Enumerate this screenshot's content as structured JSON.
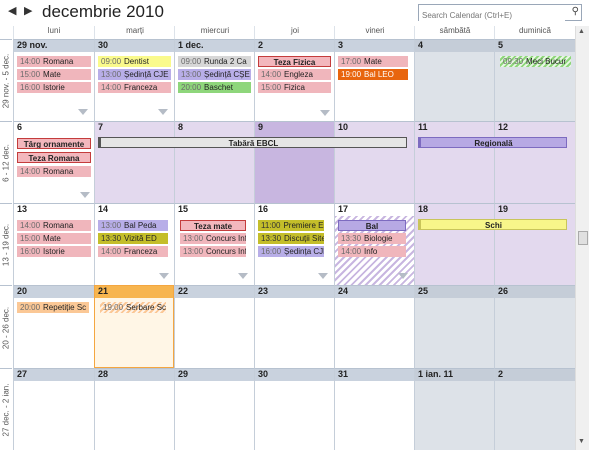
{
  "header": {
    "prev_label": "◀",
    "next_label": "▶",
    "title": "decembrie 2010",
    "search_placeholder": "Search Calendar (Ctrl+E)",
    "search_icon": "magnifier-icon"
  },
  "day_names": [
    "luni",
    "marți",
    "miercuri",
    "joi",
    "vineri",
    "sâmbătă",
    "duminică"
  ],
  "weeks": [
    {
      "label": "29 nov. - 5 dec.",
      "days": [
        "29 nov.",
        "30",
        "1 dec.",
        "2",
        "3",
        "4",
        "5"
      ]
    },
    {
      "label": "6 - 12 dec.",
      "days": [
        "6",
        "7",
        "8",
        "9",
        "10",
        "11",
        "12"
      ]
    },
    {
      "label": "13 - 19 dec.",
      "days": [
        "13",
        "14",
        "15",
        "16",
        "17",
        "18",
        "19"
      ]
    },
    {
      "label": "20 - 26 dec.",
      "days": [
        "20",
        "21",
        "22",
        "23",
        "24",
        "25",
        "26"
      ]
    },
    {
      "label": "27 dec. - 2 ian.",
      "days": [
        "27",
        "28",
        "29",
        "30",
        "31",
        "1 ian. 11",
        "2"
      ]
    }
  ],
  "events": {
    "w1": {
      "mon": [
        {
          "time": "14:00",
          "title": "Romana"
        },
        {
          "time": "15:00",
          "title": "Mate"
        },
        {
          "time": "16:00",
          "title": "Istorie"
        }
      ],
      "tue": [
        {
          "time": "09:00",
          "title": "Dentist"
        },
        {
          "time": "13:00",
          "title": "Ședință CJE"
        },
        {
          "time": "14:00",
          "title": "Franceza"
        }
      ],
      "wed": [
        {
          "time": "09:00",
          "title": "Runda 2 Ca"
        },
        {
          "time": "13:00",
          "title": "Ședință CȘE"
        },
        {
          "time": "20:00",
          "title": "Baschet"
        }
      ],
      "thu_allday": "Teza Fizica",
      "thu": [
        {
          "time": "14:00",
          "title": "Engleza"
        },
        {
          "time": "15:00",
          "title": "Fizica"
        }
      ],
      "fri": [
        {
          "time": "17:00",
          "title": "Mate"
        },
        {
          "time": "19:00",
          "title": "Bal LEO"
        }
      ],
      "sun": [
        {
          "time": "09:30",
          "title": "Meci Bucur"
        }
      ]
    },
    "w2": {
      "mon_allday": [
        "Târg ornamente",
        "Teza Romana"
      ],
      "mon": [
        {
          "time": "14:00",
          "title": "Romana"
        }
      ],
      "multi": "Tabără EBCL",
      "weekend": "Regională"
    },
    "w3": {
      "mon": [
        {
          "time": "14:00",
          "title": "Romana"
        },
        {
          "time": "15:00",
          "title": "Mate"
        },
        {
          "time": "16:00",
          "title": "Istorie"
        }
      ],
      "tue": [
        {
          "time": "13:00",
          "title": "Bal Peda"
        },
        {
          "time": "13:30",
          "title": "Vizită ED"
        },
        {
          "time": "14:00",
          "title": "Franceza"
        }
      ],
      "wed_allday": "Teza mate",
      "wed": [
        {
          "time": "13:00",
          "title": "Concurs Inf"
        },
        {
          "time": "13:00",
          "title": "Concurs Inf"
        }
      ],
      "thu": [
        {
          "time": "11:00",
          "title": "Premiere Es"
        },
        {
          "time": "13:30",
          "title": "Discuții Site"
        },
        {
          "time": "16:00",
          "title": "Ședința CJE"
        }
      ],
      "fri_allday": "Bal",
      "fri": [
        {
          "time": "13:30",
          "title": "Biologie"
        },
        {
          "time": "14:00",
          "title": "Info"
        }
      ],
      "weekend": "Schi"
    },
    "w4": {
      "mon": [
        {
          "time": "20:00",
          "title": "Repetiție Sc"
        }
      ],
      "tue": [
        {
          "time": "19:00",
          "title": "Serbare Sc"
        }
      ]
    }
  },
  "colors": {
    "weekend_bg": "#dde2e8",
    "event_pink": "#f0b6bc",
    "event_lavender": "#b8aee8",
    "event_yellow": "#fafa8c",
    "event_orange": "#e8650e",
    "today_accent": "#f7b54f",
    "purple_range": "#e3d9ee"
  }
}
